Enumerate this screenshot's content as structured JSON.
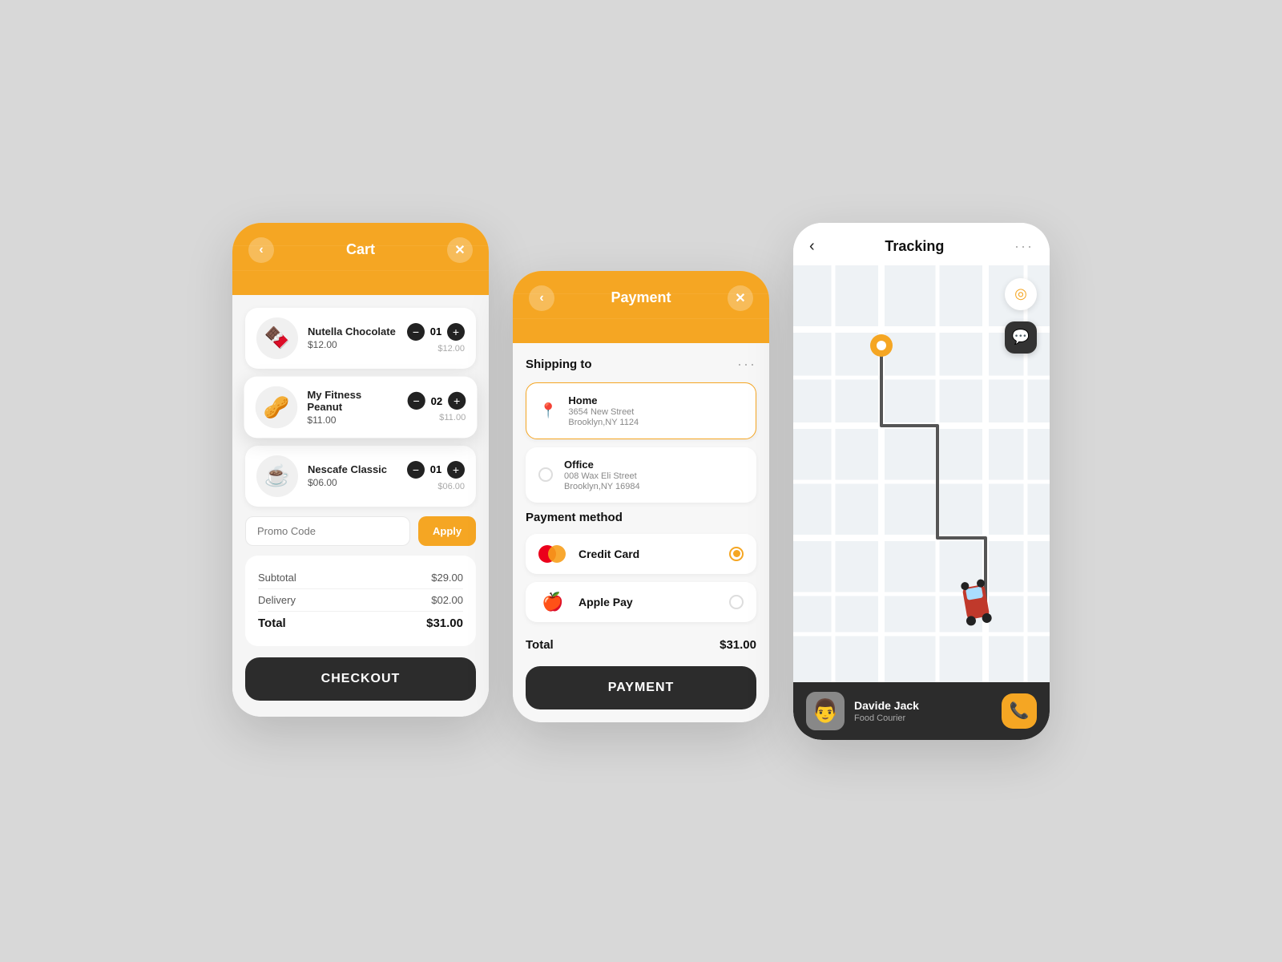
{
  "cart": {
    "title": "Cart",
    "back_icon": "‹",
    "close_icon": "✕",
    "items": [
      {
        "id": "nutella",
        "name": "Nutella Chocolate",
        "price": "$12.00",
        "quantity": "01",
        "total": "$12.00",
        "emoji": "🍫"
      },
      {
        "id": "peanut",
        "name": "My Fitness Peanut",
        "price": "$11.00",
        "quantity": "02",
        "total": "$11.00",
        "emoji": "🥜",
        "elevated": true
      },
      {
        "id": "nescafe",
        "name": "Nescafe Classic",
        "price": "$06.00",
        "quantity": "01",
        "total": "$06.00",
        "emoji": "☕"
      }
    ],
    "promo": {
      "placeholder": "Promo Code",
      "button_label": "Apply"
    },
    "subtotal_label": "Subtotal",
    "subtotal_value": "$29.00",
    "delivery_label": "Delivery",
    "delivery_value": "$02.00",
    "total_label": "Total",
    "total_value": "$31.00",
    "checkout_label": "CHECKOUT"
  },
  "payment": {
    "title": "Payment",
    "back_icon": "‹",
    "close_icon": "✕",
    "shipping_section_label": "Shipping to",
    "dots": "···",
    "addresses": [
      {
        "id": "home",
        "name": "Home",
        "line1": "3654 New Street",
        "line2": "Brooklyn,NY 1124",
        "selected": true
      },
      {
        "id": "office",
        "name": "Office",
        "line1": "008 Wax Eli Street",
        "line2": "Brooklyn,NY 16984",
        "selected": false
      }
    ],
    "payment_method_label": "Payment method",
    "methods": [
      {
        "id": "credit_card",
        "name": "Credit Card",
        "selected": true
      },
      {
        "id": "apple_pay",
        "name": "Apple Pay",
        "selected": false
      }
    ],
    "total_label": "Total",
    "total_value": "$31.00",
    "payment_button_label": "PAYMENT"
  },
  "tracking": {
    "title": "Tracking",
    "back_icon": "‹",
    "dots": "···",
    "courier": {
      "name": "Davide Jack",
      "role": "Food Courier",
      "avatar_emoji": "👨"
    },
    "call_icon": "📞",
    "location_icon": "◎",
    "chat_icon": "💬"
  },
  "colors": {
    "orange": "#F5A623",
    "dark": "#2c2c2c",
    "bg": "#d8d8d8"
  }
}
